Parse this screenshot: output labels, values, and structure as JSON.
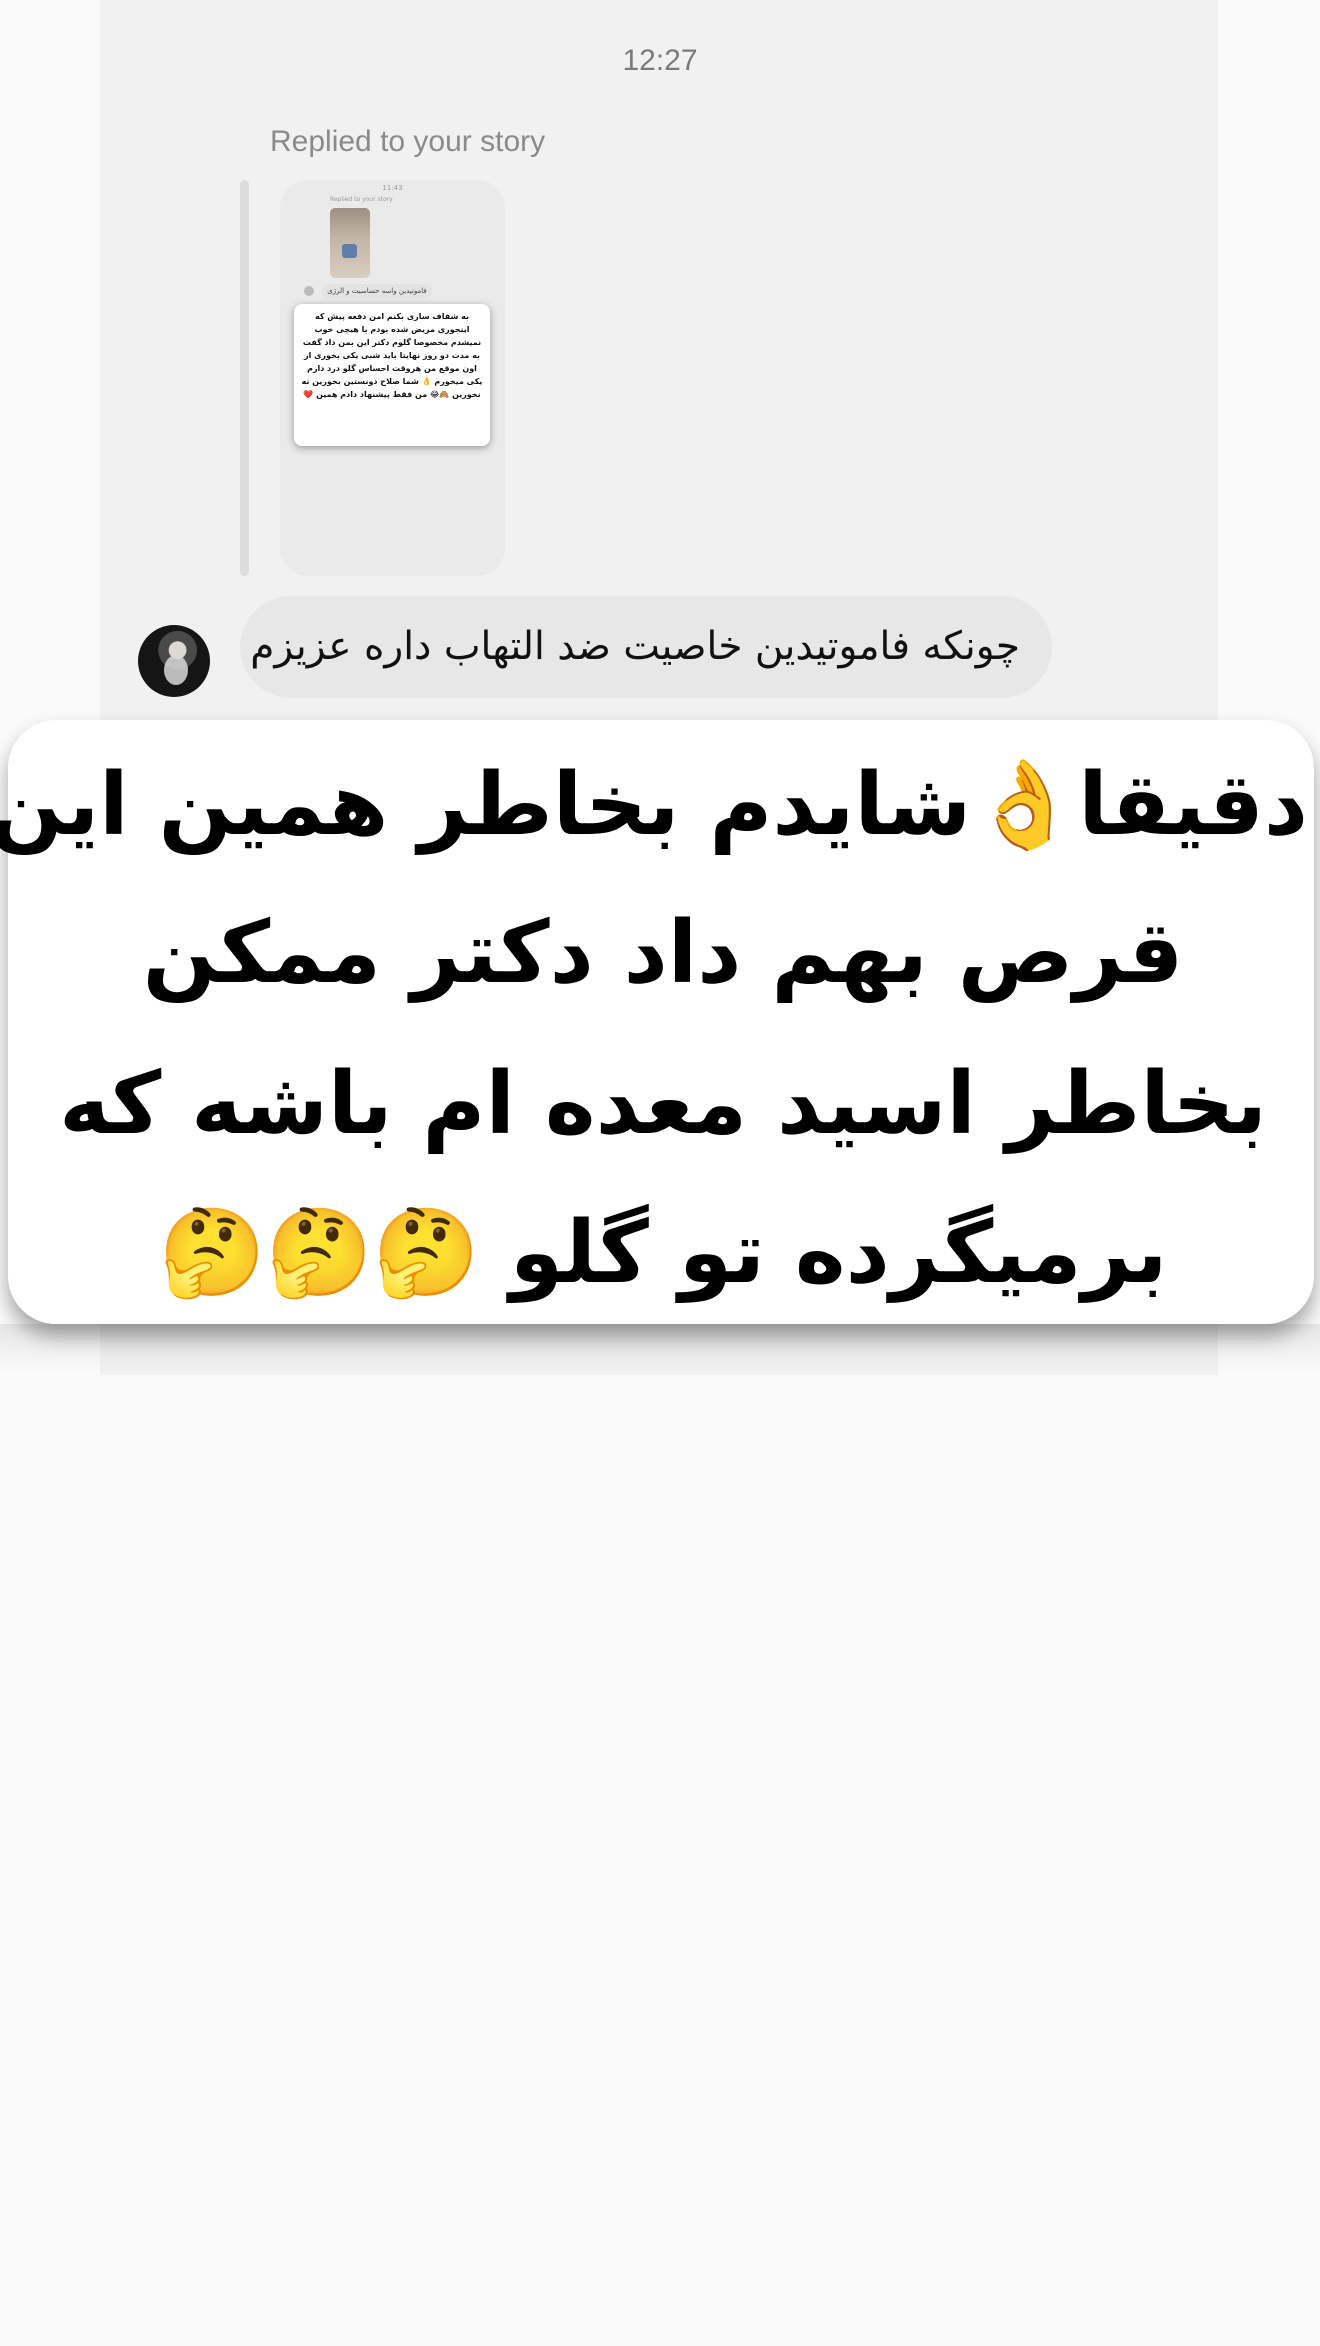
{
  "chat": {
    "timestamp": "12:27",
    "replied_label": "Replied to your story",
    "story_preview": {
      "time": "11:43",
      "replied_label": "Replied to your story",
      "caption": "فاموتیدین واسه حساسیت و الرژی",
      "text": "به شفاف سازی بکنم امن دفعه پیش که اینجوری مریض شده بودم با هیچی خوب نمیشدم مخصوصا گلوم دکتر این بمن داد گفت به مدت دو روز نهایتا باید شبی یکی بخوری از اون موقع من هروقت احساس گلو درد دارم یکی میخورم 👌 شما صلاح دونستین بخورین نه نخورین 🙈😂 من فقط پیشنهاد دادم همین ❤️"
    },
    "message": "چونکه فاموتیدین خاصیت ضد التهاب داره عزیزم"
  },
  "overlay": {
    "line1": "دقیقا👌شایدم بخاطر همین این",
    "line2": "قرص بهم داد دکتر ممکن",
    "line3": "بخاطر اسید معده ام باشه که",
    "line4": "برمیگرده تو گلو 🤔🤔🤔"
  },
  "colors": {
    "background": "#fafafa",
    "chat_bg": "#f1f1f1",
    "bubble": "#e7e7e7",
    "text_dark": "#111111",
    "meta_text": "#7a7a7a"
  },
  "icons": {
    "avatar": "profile-avatar",
    "emoji_ok": "ok-hand-icon",
    "emoji_thinking": "thinking-face-icon"
  }
}
